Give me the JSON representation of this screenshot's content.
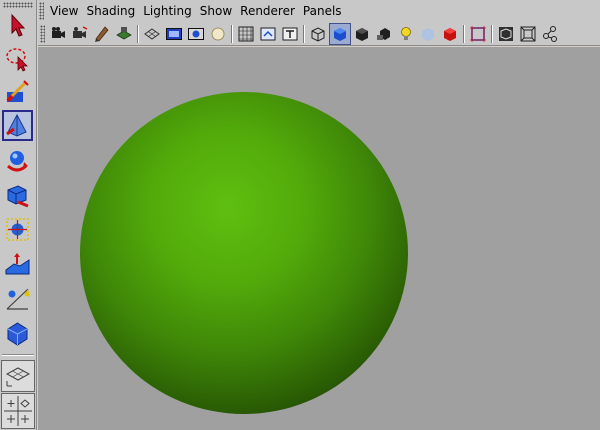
{
  "menubar": {
    "items": [
      "View",
      "Shading",
      "Lighting",
      "Show",
      "Renderer",
      "Panels"
    ]
  },
  "toolbox": {
    "tools": [
      {
        "name": "select-tool-icon"
      },
      {
        "name": "lasso-tool-icon"
      },
      {
        "name": "paint-select-tool-icon"
      },
      {
        "name": "move-tool-icon",
        "active": true
      },
      {
        "name": "rotate-tool-icon"
      },
      {
        "name": "scale-tool-icon"
      },
      {
        "name": "universal-manipulator-icon"
      },
      {
        "name": "soft-modification-icon"
      },
      {
        "name": "show-manipulator-icon"
      },
      {
        "name": "last-tool-used-icon"
      }
    ],
    "layouts": [
      {
        "name": "single-perspective-layout-icon"
      },
      {
        "name": "four-view-layout-icon"
      }
    ]
  },
  "iconbar": {
    "buttons": [
      "select-camera-icon",
      "camera-attributes-icon",
      "bookmarks-icon",
      "image-plane-icon",
      "grid-icon",
      "film-gate-icon",
      "resolution-gate-icon",
      "gate-mask-icon",
      "field-chart-icon",
      "safe-action-icon",
      "safe-title-icon",
      "wireframe-icon",
      "smooth-shade-icon",
      "flat-shade-icon",
      "use-lights-icon",
      "xray-icon",
      "isolate-select-icon",
      "frame-all-icon",
      "frame-selected-icon",
      "textured-icon"
    ]
  },
  "viewport": {
    "background": "#a0a0a0",
    "object_color": "#52aa0a"
  }
}
